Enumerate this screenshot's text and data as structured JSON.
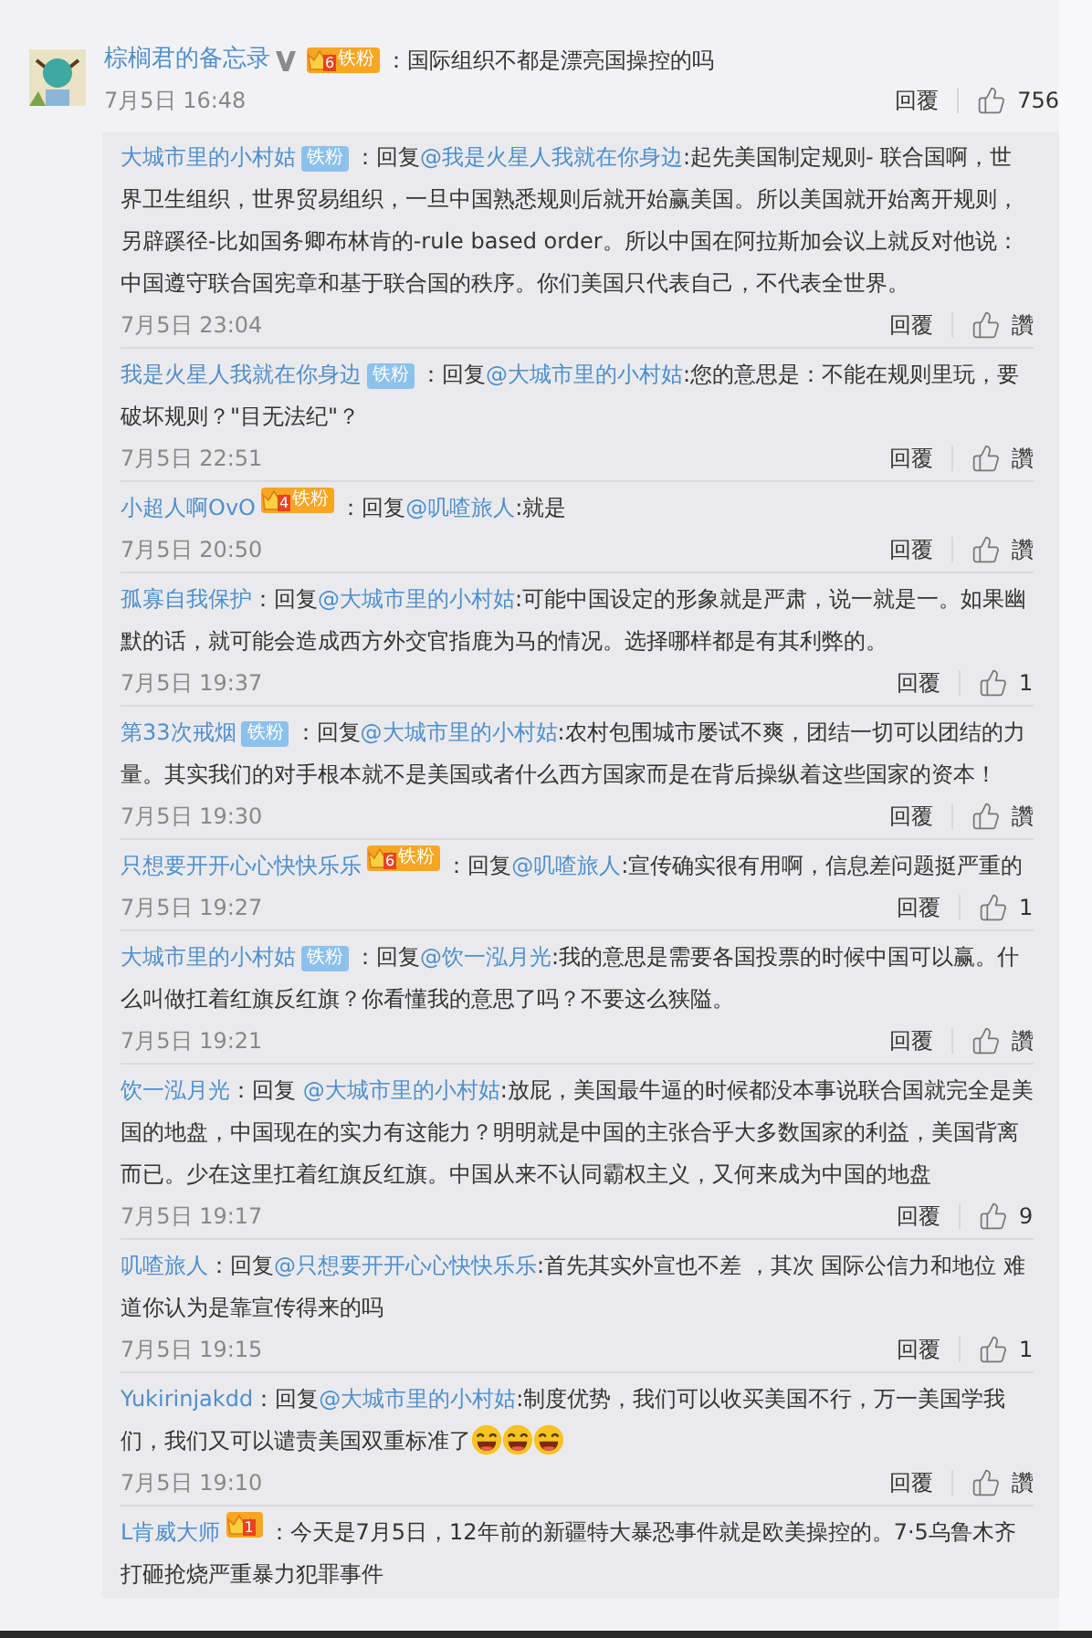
{
  "comment": {
    "author": "棕榈君的备忘录",
    "verified": true,
    "badge": {
      "kind": "crown",
      "level": "6",
      "label": "铁粉"
    },
    "separator": "：",
    "text": "国际组织不都是漂亮国操控的吗",
    "time": "7月5日 16:48",
    "reply_label": "回覆",
    "likes": "756"
  },
  "replies": [
    {
      "author": "大城市里的小村姑",
      "badge": {
        "kind": "plain",
        "label": "铁粉"
      },
      "prefix": "：回复",
      "mention": "@我是火星人我就在你身边",
      "text": ":起先美国制定规则- 联合国啊，世界卫生组织，世界贸易组织，一旦中国熟悉规则后就开始赢美国。所以美国就开始离开规则，另辟蹊径-比如国务卿布林肯的-rule based order。所以中国在阿拉斯加会议上就反对他说：中国遵守联合国宪章和基于联合国的秩序。你们美国只代表自己，不代表全世界。",
      "time": "7月5日 23:04",
      "reply_label": "回覆",
      "likes": "讚"
    },
    {
      "author": "我是火星人我就在你身边",
      "badge": {
        "kind": "plain",
        "label": "铁粉"
      },
      "prefix": "：回复",
      "mention": "@大城市里的小村姑",
      "text": ":您的意思是：不能在规则里玩，要破坏规则？\"目无法纪\"？",
      "time": "7月5日 22:51",
      "reply_label": "回覆",
      "likes": "讚"
    },
    {
      "author": "小超人啊OvO",
      "badge": {
        "kind": "crown",
        "level": "4",
        "label": "铁粉"
      },
      "prefix": "：回复",
      "mention": "@叽喳旅人",
      "text": ":就是",
      "time": "7月5日 20:50",
      "reply_label": "回覆",
      "likes": "讚"
    },
    {
      "author": "孤寡自我保护",
      "prefix": "：回复",
      "mention": "@大城市里的小村姑",
      "text": ":可能中国设定的形象就是严肃，说一就是一。如果幽默的话，就可能会造成西方外交官指鹿为马的情况。选择哪样都是有其利弊的。",
      "time": "7月5日 19:37",
      "reply_label": "回覆",
      "likes": "1"
    },
    {
      "author": "第33次戒烟",
      "badge": {
        "kind": "plain",
        "label": "铁粉"
      },
      "prefix": "：回复",
      "mention": "@大城市里的小村姑",
      "text": ":农村包围城市屡试不爽，团结一切可以团结的力量。其实我们的对手根本就不是美国或者什么西方国家而是在背后操纵着这些国家的资本！",
      "time": "7月5日 19:30",
      "reply_label": "回覆",
      "likes": "讚"
    },
    {
      "author": "只想要开开心心快快乐乐",
      "badge": {
        "kind": "crown",
        "level": "6",
        "label": "铁粉"
      },
      "prefix": "：回复",
      "mention": "@叽喳旅人",
      "text": ":宣传确实很有用啊，信息差问题挺严重的",
      "time": "7月5日 19:27",
      "reply_label": "回覆",
      "likes": "1"
    },
    {
      "author": "大城市里的小村姑",
      "badge": {
        "kind": "plain",
        "label": "铁粉"
      },
      "prefix": "：回复",
      "mention": "@饮一泓月光",
      "text": ":我的意思是需要各国投票的时候中国可以赢。什么叫做扛着红旗反红旗？你看懂我的意思了吗？不要这么狭隘。",
      "time": "7月5日 19:21",
      "reply_label": "回覆",
      "likes": "讚"
    },
    {
      "author": "饮一泓月光",
      "prefix": "：回复 ",
      "mention": "@大城市里的小村姑",
      "text": ":放屁，美国最牛逼的时候都没本事说联合国就完全是美国的地盘，中国现在的实力有这能力？明明就是中国的主张合乎大多数国家的利益，美国背离而已。少在这里扛着红旗反红旗。中国从来不认同霸权主义，又何来成为中国的地盘",
      "time": "7月5日 19:17",
      "reply_label": "回覆",
      "likes": "9"
    },
    {
      "author": "叽喳旅人",
      "prefix": "：回复",
      "mention": "@只想要开开心心快快乐乐",
      "text": ":首先其实外宣也不差 ，其次 国际公信力和地位 难道你认为是靠宣传得来的吗",
      "time": "7月5日 19:15",
      "reply_label": "回覆",
      "likes": "1"
    },
    {
      "author": "Yukirinjakdd",
      "prefix": "：回复",
      "mention": "@大城市里的小村姑",
      "text": ":制度优势，我们可以收买美国不行，万一美国学我们，我们又可以谴责美国双重标准了",
      "emoji_after": true,
      "time": "7月5日 19:10",
      "reply_label": "回覆",
      "likes": "讚"
    },
    {
      "author": "L肯威大师",
      "badge": {
        "kind": "crown",
        "level": "1"
      },
      "prefix": "：",
      "text": "今天是7月5日，12年前的新疆特大暴恐事件就是欧美操控的。7·5乌鲁木齐打砸抢烧严重暴力犯罪事件"
    }
  ]
}
